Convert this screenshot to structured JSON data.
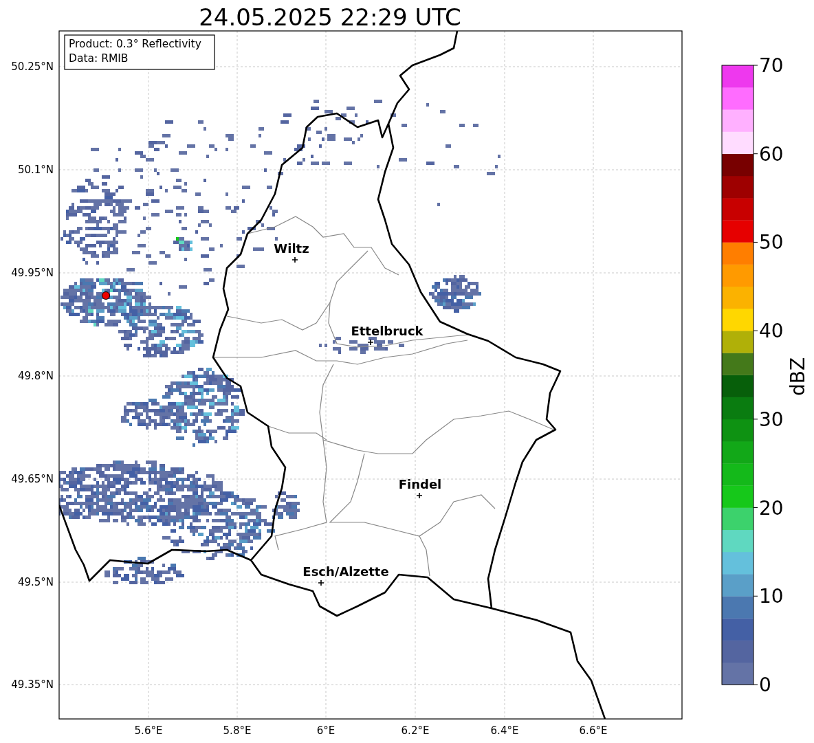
{
  "title": "24.05.2025 22:29 UTC",
  "legend_box": {
    "lines": [
      "Product: 0.3° Reflectivity",
      "Data: RMIB"
    ]
  },
  "lat_ticks": [
    "50.25°N",
    "50.1°N",
    "49.95°N",
    "49.8°N",
    "49.65°N",
    "49.5°N",
    "49.35°N"
  ],
  "lon_ticks": [
    "5.6°E",
    "5.8°E",
    "6°E",
    "6.2°E",
    "6.4°E",
    "6.6°E"
  ],
  "cities": [
    {
      "name": "Wiltz"
    },
    {
      "name": "Ettelbruck"
    },
    {
      "name": "Findel"
    },
    {
      "name": "Esch/Alzette"
    }
  ],
  "colorbar": {
    "label": "dBZ",
    "ticks": [
      "70",
      "60",
      "50",
      "40",
      "30",
      "20",
      "10",
      "0"
    ],
    "segments": [
      {
        "color": "#6473a6"
      },
      {
        "color": "#5465a0"
      },
      {
        "color": "#4460a5"
      },
      {
        "color": "#4b78b0"
      },
      {
        "color": "#5a9fc8"
      },
      {
        "color": "#64c0dc"
      },
      {
        "color": "#5fd8c0"
      },
      {
        "color": "#3cd26c"
      },
      {
        "color": "#16c81a"
      },
      {
        "color": "#14b91a"
      },
      {
        "color": "#12a818"
      },
      {
        "color": "#0e9212"
      },
      {
        "color": "#0a7c10"
      },
      {
        "color": "#075f0a"
      },
      {
        "color": "#44791a"
      },
      {
        "color": "#b0b008"
      },
      {
        "color": "#ffd700"
      },
      {
        "color": "#fbb200"
      },
      {
        "color": "#ff9a00"
      },
      {
        "color": "#ff7e00"
      },
      {
        "color": "#e60000"
      },
      {
        "color": "#c80000"
      },
      {
        "color": "#9e0000"
      },
      {
        "color": "#780000"
      },
      {
        "color": "#ffdcff"
      },
      {
        "color": "#ffb0ff"
      },
      {
        "color": "#ff6cff"
      },
      {
        "color": "#ee38ee"
      }
    ]
  }
}
